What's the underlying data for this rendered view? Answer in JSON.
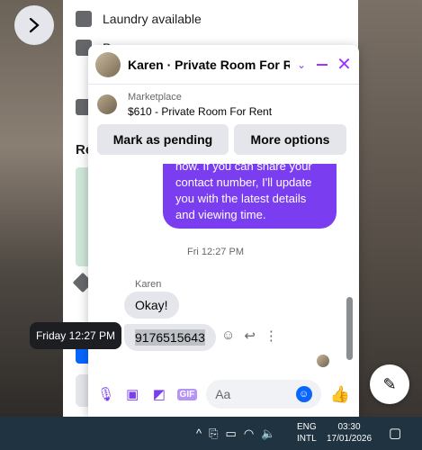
{
  "listing_page": {
    "row1_label": "Laundry available",
    "row2_label": "P",
    "heading": "Re"
  },
  "chat": {
    "title": "Karen · Private Room For R...",
    "marketplace_label": "Marketplace",
    "listing": "$610 - Private Room For Rent",
    "actions": {
      "pending": "Mark as pending",
      "more": "More options"
    },
    "outgoing_message": "now. If you can share your contact number, I'll update you with the latest details and viewing time.",
    "timestamp": "Fri 12:27 PM",
    "sender": "Karen",
    "incoming": [
      "Okay!",
      "9176515643"
    ],
    "composer_placeholder": "Aa"
  },
  "tooltip": "Friday 12:27 PM",
  "taskbar": {
    "lang1": "ENG",
    "lang2": "INTL",
    "time": "03:30",
    "date": "17/01/2026"
  },
  "colors": {
    "accent": "#7b3df0",
    "facebook_blue": "#0866ff",
    "header_icon": "#a033ff"
  }
}
